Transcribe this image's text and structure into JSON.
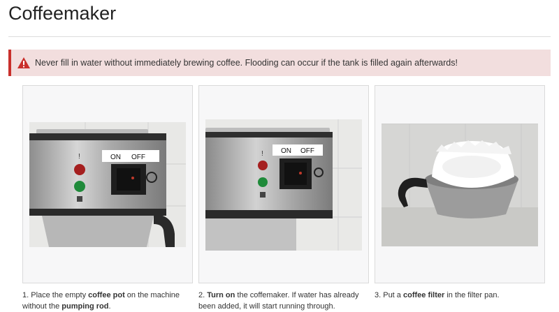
{
  "page": {
    "title": "Coffeemaker"
  },
  "alert": {
    "icon": "warning-icon",
    "color": "#c9302c",
    "background": "#f2dede",
    "text": "Never fill in water without immediately brewing coffee. Flooding can occur if the tank is filled again afterwards!"
  },
  "steps": [
    {
      "image_labels": {
        "on": "ON",
        "off": "OFF"
      },
      "caption": {
        "pre": "1. Place the empty ",
        "b1": "coffee pot",
        "mid": " on the machine without the ",
        "b2": "pumping rod",
        "post": "."
      }
    },
    {
      "image_labels": {
        "on": "ON",
        "off": "OFF"
      },
      "caption": {
        "pre": "2. ",
        "b1": "Turn on",
        "mid": " the coffemaker. If water has already been added, it will start running through.",
        "b2": "",
        "post": ""
      }
    },
    {
      "caption": {
        "pre": "3. Put a ",
        "b1": "coffee filter",
        "mid": " in the filter pan.",
        "b2": "",
        "post": ""
      }
    }
  ]
}
